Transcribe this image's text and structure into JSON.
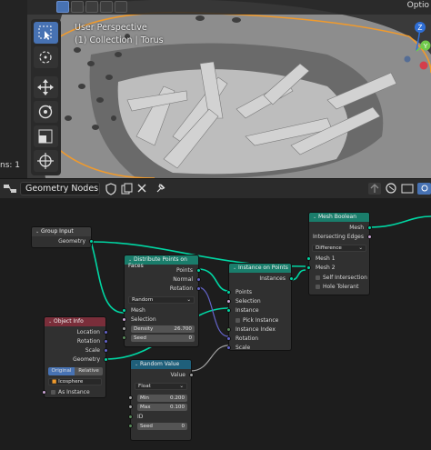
{
  "viewport": {
    "left_panel_text": "ns: 1",
    "header_right_label": "Optio",
    "perspective": "User Perspective",
    "collection": "(1) Collection | Torus",
    "tools": [
      "select-box-icon",
      "cursor-icon",
      "move-icon",
      "rotate-icon",
      "scale-icon",
      "transform-icon"
    ],
    "gizmo_axes": [
      "Z",
      "Y"
    ]
  },
  "node_editor": {
    "editor_type_icon": "node-editor-icon",
    "tree_name": "Geometry Nodes",
    "header_icons": [
      "shield-icon",
      "copy-icon",
      "close-icon",
      "pin-icon",
      "arrow-up-icon",
      "toggle-icon",
      "view-icon"
    ]
  },
  "nodes": {
    "group_input": {
      "title": "Group Input",
      "geometry": "Geometry"
    },
    "distribute": {
      "title": "Distribute Points on Faces",
      "out_points": "Points",
      "out_normal": "Normal",
      "out_rotation": "Rotation",
      "mode": "Random",
      "mesh": "Mesh",
      "selection": "Selection",
      "density_label": "Density",
      "density_value": "26.700",
      "seed_label": "Seed",
      "seed_value": "0"
    },
    "instance_on_points": {
      "title": "Instance on Points",
      "out_instances": "Instances",
      "points": "Points",
      "selection": "Selection",
      "instance": "Instance",
      "pick_instance": "Pick Instance",
      "instance_index": "Instance Index",
      "rotation": "Rotation",
      "scale": "Scale"
    },
    "mesh_boolean": {
      "title": "Mesh Boolean",
      "out_mesh": "Mesh",
      "out_intersecting": "Intersecting Edges",
      "operation": "Difference",
      "mesh1": "Mesh 1",
      "mesh2": "Mesh 2",
      "self_intersection": "Self Intersection",
      "hole_tolerant": "Hole Tolerant"
    },
    "object_info": {
      "title": "Object Info",
      "location": "Location",
      "rotation": "Rotation",
      "scale": "Scale",
      "geometry": "Geometry",
      "tab_original": "Original",
      "tab_relative": "Relative",
      "object_name": "Icosphere",
      "as_instance": "As Instance"
    },
    "random_value": {
      "title": "Random Value",
      "out_value": "Value",
      "type": "Float",
      "min_label": "Min",
      "min_value": "0.200",
      "max_label": "Max",
      "max_value": "0.100",
      "id_label": "ID",
      "seed_label": "Seed",
      "seed_value": "0"
    }
  },
  "colors": {
    "accent_blue": "#4772b3",
    "geometry_link": "#00d6a3",
    "selection_orange": "#f09a2c",
    "vector_socket": "#6363c7"
  }
}
